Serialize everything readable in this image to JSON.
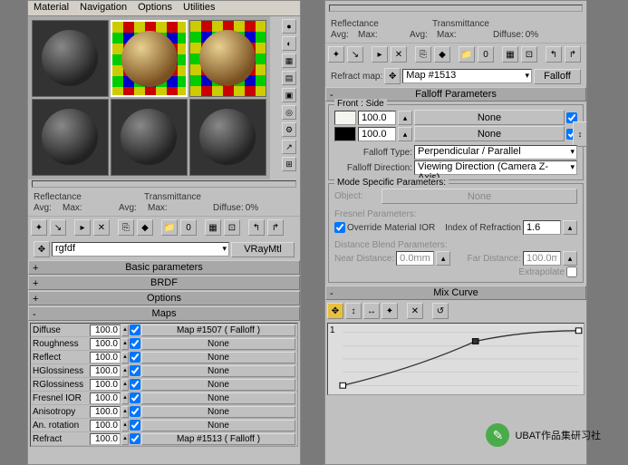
{
  "menu": {
    "material": "Material",
    "navigation": "Navigation",
    "options": "Options",
    "utilities": "Utilities"
  },
  "stats": {
    "reflectance": "Reflectance",
    "transmittance": "Transmittance",
    "avg": "Avg:",
    "max": "Max:",
    "diffuse": "Diffuse:",
    "diffuse_val": "0%"
  },
  "picker": {
    "name": "rgfdf",
    "type": "VRayMtl"
  },
  "rollouts": {
    "basic": "Basic parameters",
    "brdf": "BRDF",
    "options": "Options",
    "maps": "Maps",
    "falloff": "Falloff Parameters",
    "mode": "Mode Specific Parameters:",
    "mixcurve": "Mix Curve"
  },
  "maps": [
    {
      "name": "Diffuse",
      "val": "100.0",
      "on": true,
      "map": "Map #1507 ( Falloff )"
    },
    {
      "name": "Roughness",
      "val": "100.0",
      "on": true,
      "map": "None"
    },
    {
      "name": "Reflect",
      "val": "100.0",
      "on": true,
      "map": "None"
    },
    {
      "name": "HGlossiness",
      "val": "100.0",
      "on": true,
      "map": "None"
    },
    {
      "name": "RGlossiness",
      "val": "100.0",
      "on": true,
      "map": "None"
    },
    {
      "name": "Fresnel IOR",
      "val": "100.0",
      "on": true,
      "map": "None"
    },
    {
      "name": "Anisotropy",
      "val": "100.0",
      "on": true,
      "map": "None"
    },
    {
      "name": "An. rotation",
      "val": "100.0",
      "on": true,
      "map": "None"
    },
    {
      "name": "Refract",
      "val": "100.0",
      "on": true,
      "map": "Map #1513 ( Falloff )"
    }
  ],
  "refract": {
    "label": "Refract map:",
    "map": "Map #1513",
    "btn": "Falloff"
  },
  "falloff": {
    "group": "Front : Side",
    "v1": "100.0",
    "m1": "None",
    "v2": "100.0",
    "m2": "None",
    "type_lbl": "Falloff Type:",
    "type": "Perpendicular / Parallel",
    "dir_lbl": "Falloff Direction:",
    "dir": "Viewing Direction (Camera Z-Axis)"
  },
  "mode": {
    "object": "Object:",
    "object_val": "None",
    "fresnel": "Fresnel Parameters:",
    "override": "Override Material IOR",
    "ior_lbl": "Index of Refraction",
    "ior": "1.6",
    "dist": "Distance Blend Parameters:",
    "near_lbl": "Near Distance:",
    "near": "0.0mm",
    "far_lbl": "Far Distance:",
    "far": "100.0mm",
    "extrap": "Extrapolate"
  },
  "curve": {
    "ylabel": "1"
  },
  "watermark": "UBAT作品集研习社",
  "colors": {
    "swatch_white": "#f5f5f0",
    "swatch_black": "#000000"
  }
}
